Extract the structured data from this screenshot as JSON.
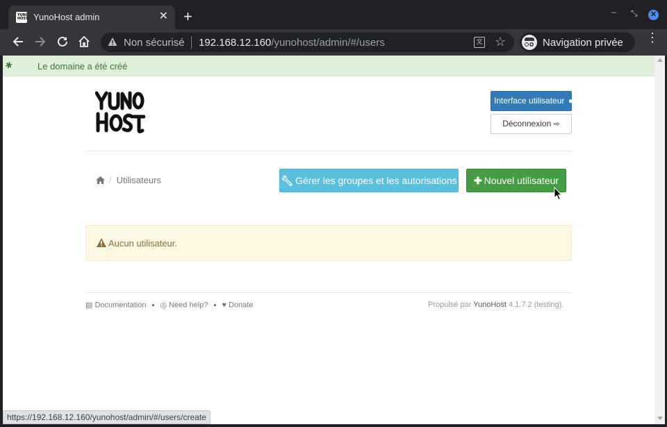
{
  "browser": {
    "tab_title": "YunoHost admin",
    "tab_favicon_text": "YUNO HOST",
    "security_label": "Non sécurisé",
    "url_host": "192.168.12.160",
    "url_path": "/yunohost/admin/#/users",
    "incognito_label": "Navigation privée",
    "status_url": "https://192.168.12.160/yunohost/admin/#/users/create"
  },
  "flash": {
    "message": "Le domaine a été créé"
  },
  "header": {
    "logo_text": "YunoHost",
    "user_interface_label": "Interface utilisateur",
    "logout_label": "Déconnexion"
  },
  "breadcrumb": {
    "current": "Utilisateurs"
  },
  "actions": {
    "manage_groups_label": "Gérer les groupes et les autorisations",
    "new_user_label": "Nouvel utilisateur"
  },
  "alert": {
    "message": "Aucun utilisateur."
  },
  "footer": {
    "documentation": "Documentation",
    "help": "Need help?",
    "donate": "Donate",
    "powered_by": "Propulsé par",
    "brand": "YunoHost",
    "version": "4.1.7.2 (testing)."
  },
  "colors": {
    "primary": "#337ab7",
    "info": "#5bc0de",
    "success": "#449d44",
    "flash_bg": "#dff0d8",
    "alert_bg": "#fcf8e3"
  }
}
